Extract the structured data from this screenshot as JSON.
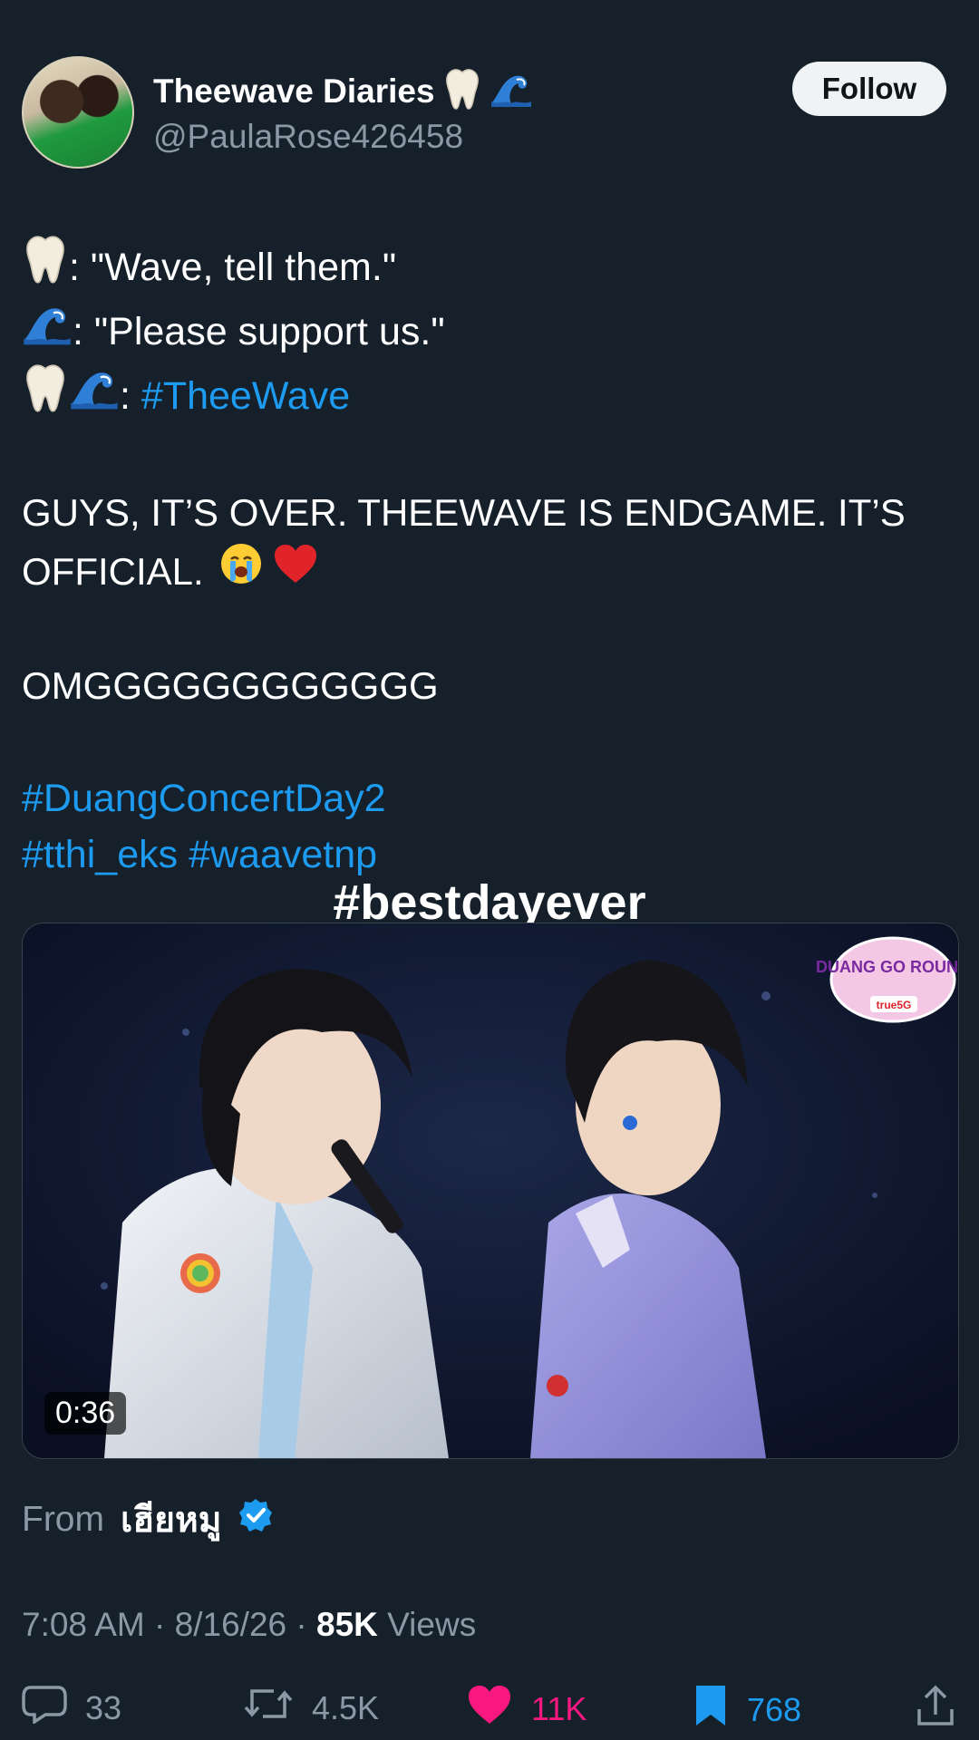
{
  "header": {
    "display_name": "Theewave Diaries",
    "handle": "@PaulaRose426458",
    "follow_label": "Follow"
  },
  "tweet": {
    "line1_text": ": \"Wave, tell them.\"",
    "line2_text": ": \"Please support us.\"",
    "line3_sep": ": ",
    "line3_hashtag": "#TheeWave",
    "para1_line1": "GUYS, IT’S OVER. THEEWAVE IS ENDGAME. IT’S",
    "para1_line2": "OFFICIAL.",
    "para2": "OMGGGGGGGGGGGG",
    "hashtag1": "#DuangConcertDay2",
    "hashtag2": "#tthi_eks",
    "hashtag3": "#waavetnp"
  },
  "video": {
    "caption": "#bestdayever",
    "duration": "0:36",
    "logo_text": "DUANG GO ROUND",
    "logo_sub": "true5G"
  },
  "source": {
    "from_label": "From",
    "from_name": "เฮียหมู"
  },
  "meta": {
    "time": "7:08 AM",
    "date": "8/16/26",
    "views_count": "85K",
    "views_label": "Views"
  },
  "actions": {
    "replies": "33",
    "reposts": "4.5K",
    "likes": "11K",
    "bookmarks": "768"
  },
  "colors": {
    "background": "#15202b",
    "link": "#1d9bf0",
    "muted": "#8b98a5",
    "like": "#f91880"
  }
}
